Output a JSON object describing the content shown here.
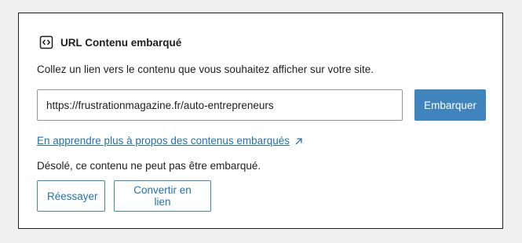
{
  "block": {
    "icon": "embed-code-icon",
    "title": "URL Contenu embarqué",
    "instructions": "Collez un lien vers le contenu que vous souhaitez afficher sur votre site.",
    "url_value": "https://frustrationmagazine.fr/auto-entrepreneurs",
    "embed_label": "Embarquer",
    "learn_more_label": "En apprendre plus à propos des contenus embarqués",
    "learn_more_icon": "external-link-icon",
    "error_message": "Désolé, ce contenu ne peut pas être embarqué.",
    "retry_label": "Réessayer",
    "convert_label": "Convertir en lien"
  },
  "colors": {
    "primary": "#3f84bd",
    "link": "#2271b1",
    "text": "#1e1e1e",
    "background": "#f0f0f0"
  }
}
